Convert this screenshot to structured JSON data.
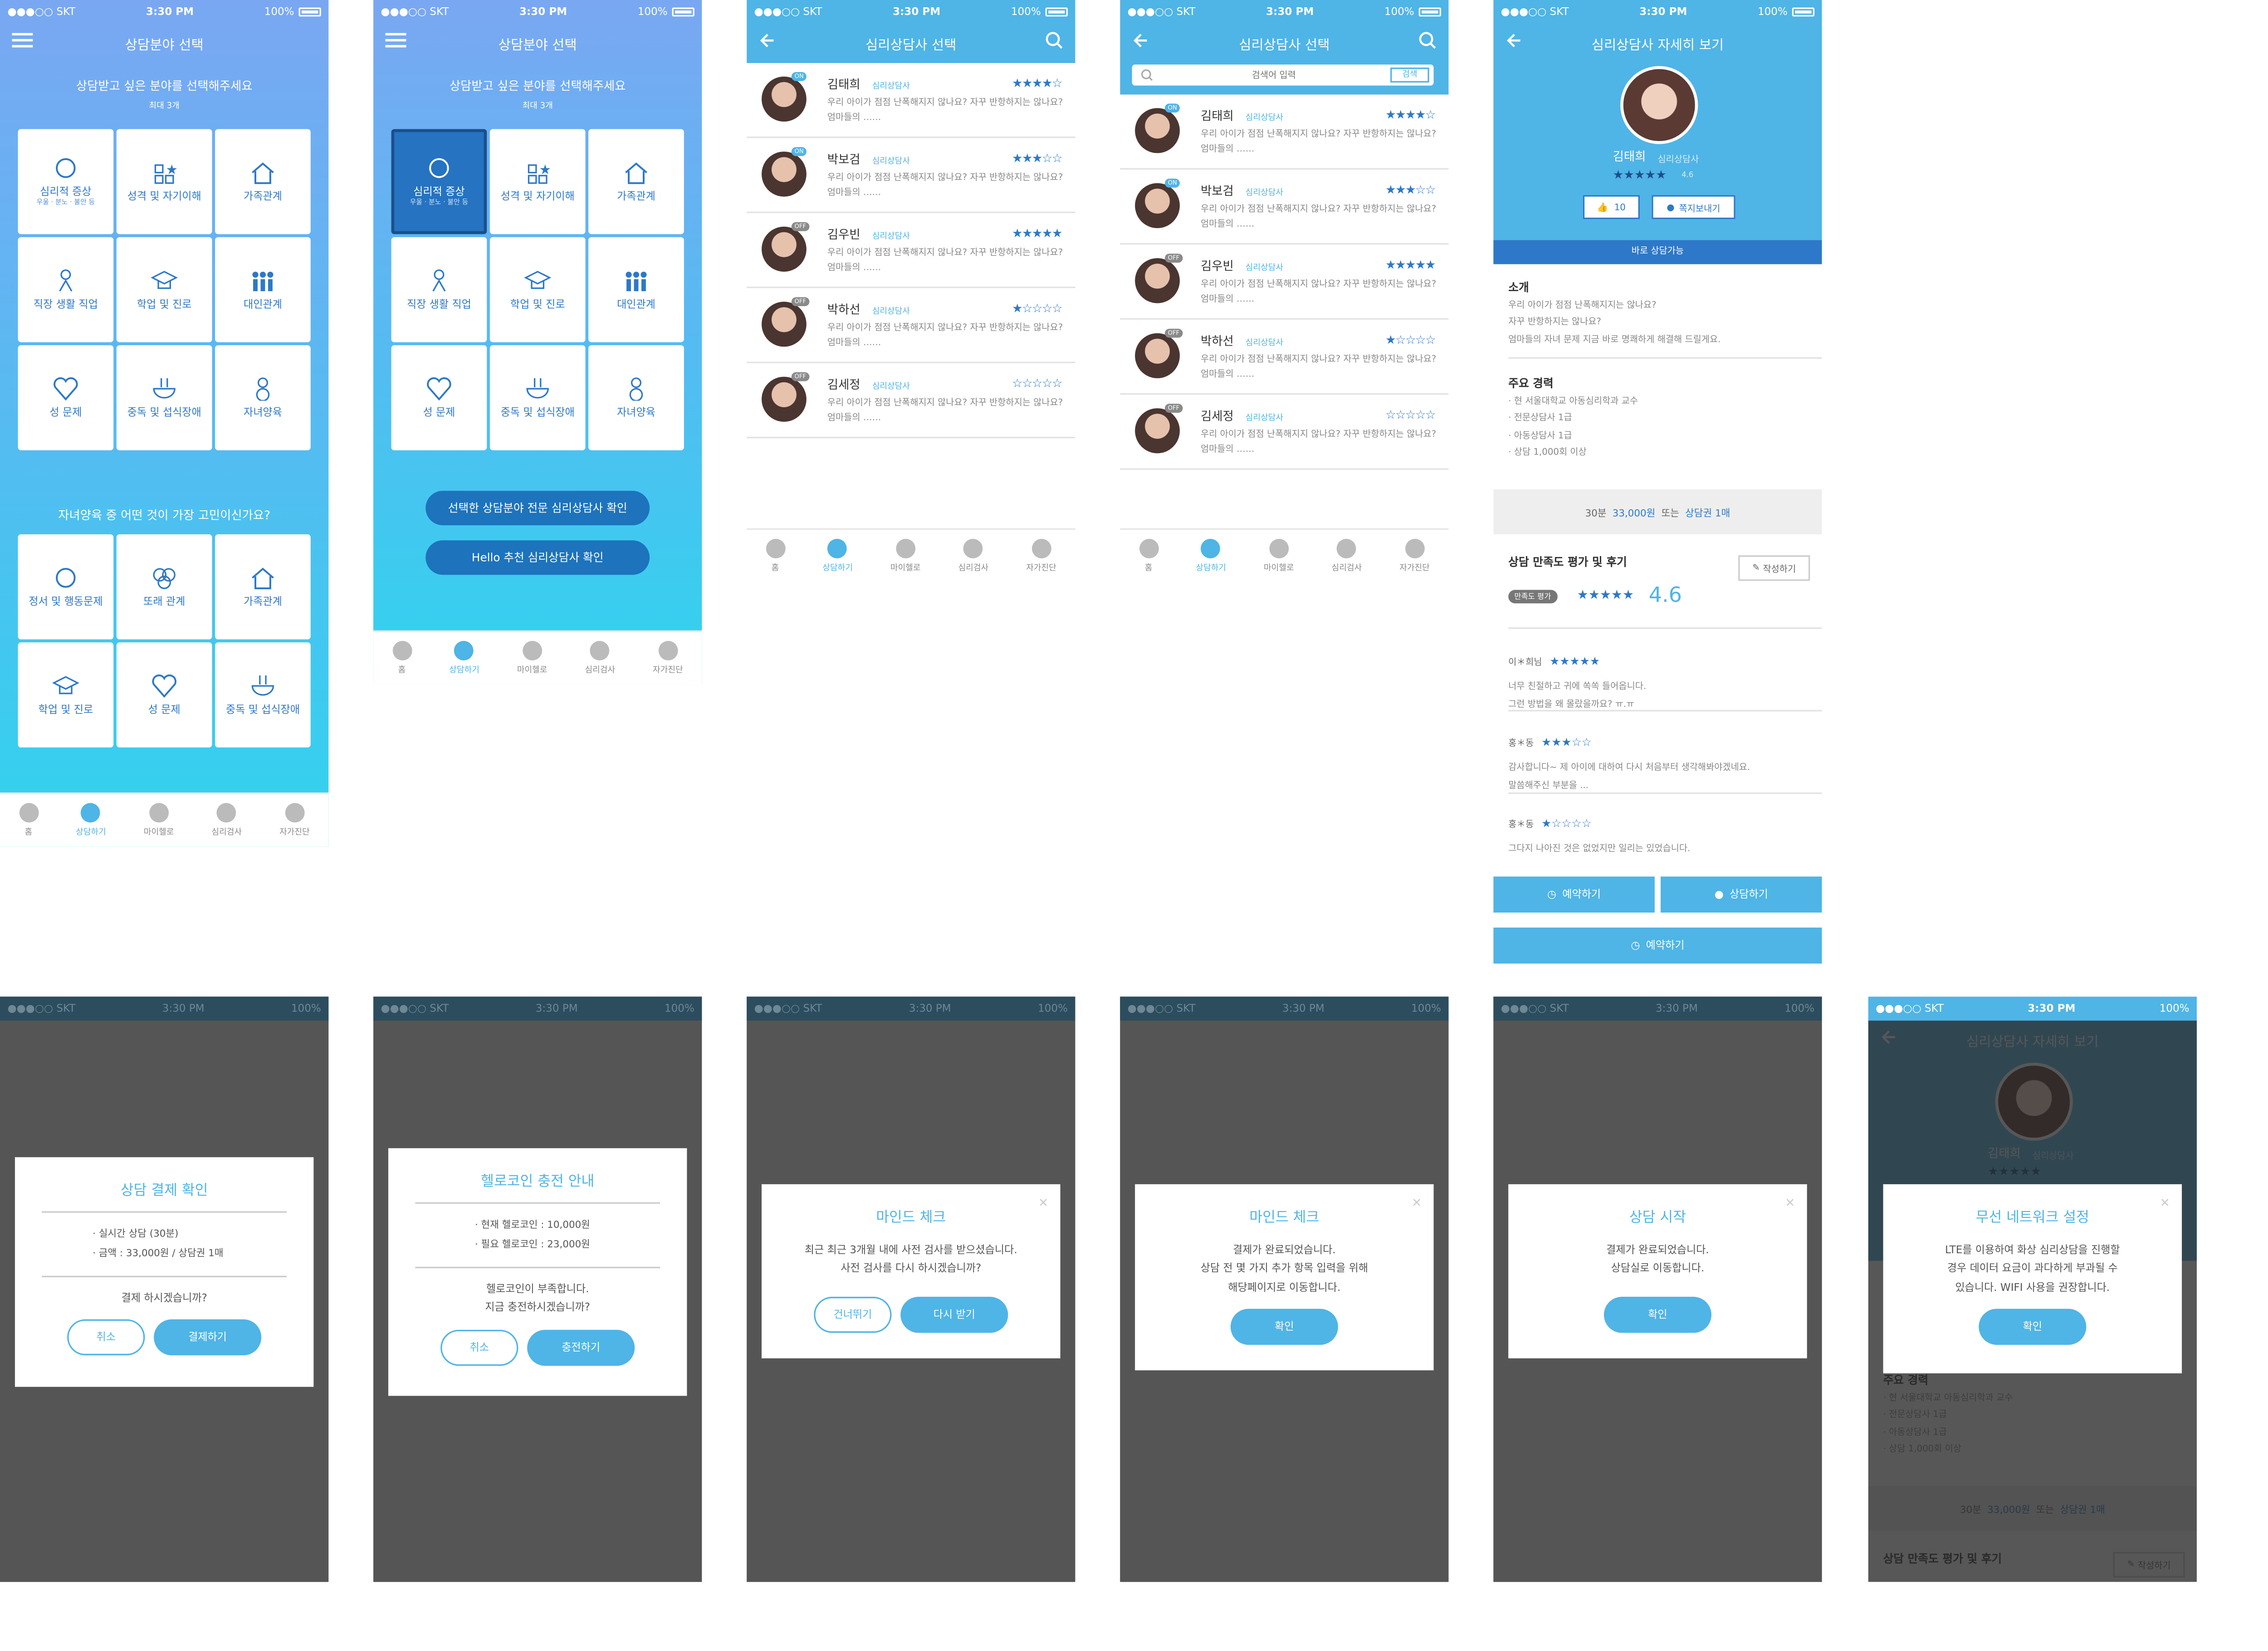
{
  "status": {
    "carrier": "●●●○○ SKT",
    "time": "3:30 PM",
    "battery": "100%"
  },
  "tabbar": [
    "홈",
    "상담하기",
    "마이헬로",
    "심리검사",
    "자가진단"
  ],
  "screen1": {
    "title": "상담분야 선택",
    "prompt": "상담받고 싶은 분야를 선택해주세요",
    "limit": "최대 3개",
    "categories": [
      {
        "label": "심리적 증상",
        "sub": "우울 · 분노 · 불안 등"
      },
      {
        "label": "성격 및 자기이해",
        "sub": ""
      },
      {
        "label": "가족관계",
        "sub": ""
      },
      {
        "label": "직장 생활 직업",
        "sub": ""
      },
      {
        "label": "학업 및 진로",
        "sub": ""
      },
      {
        "label": "대인관계",
        "sub": ""
      },
      {
        "label": "성 문제",
        "sub": ""
      },
      {
        "label": "중독 및 섭식장애",
        "sub": ""
      },
      {
        "label": "자녀양육",
        "sub": ""
      }
    ],
    "question": "자녀양육 중 어떤 것이 가장 고민이신가요?",
    "sub_categories": [
      "정서 및 행동문제",
      "또래 관계",
      "가족관계",
      "학업 및 진로",
      "성 문제",
      "중독 및 섭식장애"
    ]
  },
  "screen2": {
    "btn_confirm": "선택한 상담분야 전문 심리상담사 확인",
    "btn_recommend": "Hello 추천 심리상담사 확인"
  },
  "screen3": {
    "title": "심리상담사 선택",
    "role": "심리상담사",
    "desc": "우리 아이가 점점 난폭해지지 않나요? 자꾸 반항하지는 않나요? 엄마들의 ……",
    "counselors": [
      {
        "name": "김태희",
        "status": "ON",
        "stars": "★★★★☆"
      },
      {
        "name": "박보검",
        "status": "ON",
        "stars": "★★★☆☆"
      },
      {
        "name": "김우빈",
        "status": "OFF",
        "stars": "★★★★★"
      },
      {
        "name": "박하선",
        "status": "OFF",
        "stars": "★☆☆☆☆"
      },
      {
        "name": "김세정",
        "status": "OFF",
        "stars": "☆☆☆☆☆"
      }
    ]
  },
  "screen4": {
    "search_placeholder": "검색어 입력",
    "search_button": "검색"
  },
  "screen5": {
    "title": "심리상담사 자세히 보기",
    "name": "김태희",
    "role": "심리상담사",
    "stars": "★★★★★",
    "rating_small": "4.6",
    "likes": "10",
    "message_btn": "쪽지보내기",
    "available": "바로 상담가능",
    "intro_title": "소개",
    "intro_lines": [
      "우리 아이가 점점 난폭해지지는 않나요?",
      "자꾸 반항하지는 않나요?",
      "엄마들의 자녀 문제 지금 바로 명쾌하게 해결해 드릴게요."
    ],
    "career_title": "주요 경력",
    "career_lines": [
      "· 현 서울대학교 아동심리학과 교수",
      "· 전문상담사 1급",
      "· 아동상담사 1급",
      "· 상담 1,000회 이상"
    ],
    "price_prefix": "30분",
    "price": "33,000원",
    "price_or": "또는",
    "price_ticket": "상담권 1매",
    "review_title": "상담 만족도 평가 및 후기",
    "write": "작성하기",
    "score_label": "만족도 평가",
    "score_stars": "★★★★★",
    "score": "4.6",
    "reviews": [
      {
        "name": "이＊희님",
        "stars": "★★★★★",
        "lines": [
          "너무 친절하고 귀에 쏙쏙 들어옵니다.",
          "그런 방법을 왜 몰랐을까요? ㅠ.ㅠ"
        ]
      },
      {
        "name": "홍＊동",
        "stars": "★★★☆☆",
        "lines": [
          "감사합니다~ 제 아이에 대하여 다시 처음부터 생각해봐야겠네요.",
          "말씀해주신 부분을 ..."
        ]
      },
      {
        "name": "홍＊동",
        "stars": "★☆☆☆☆",
        "lines": [
          "그다지 나아진 것은 없었지만 일리는 있었습니다."
        ]
      }
    ],
    "btn_reserve": "예약하기",
    "btn_consult": "상담하기",
    "btn_reserve2": "예약하기"
  },
  "dialogs": {
    "payment": {
      "title": "상담 결제 확인",
      "lines": [
        "· 실시간 상담 (30분)",
        "· 금액 : 33,000원 / 상담권 1매"
      ],
      "question": "결제 하시겠습니까?",
      "cancel": "취소",
      "ok": "결제하기"
    },
    "charge": {
      "title": "헬로코인 충전 안내",
      "lines": [
        "· 현재 헬로코인 : 10,000원",
        "· 필요 헬로코인 : 23,000원"
      ],
      "body": [
        "헬로코인이 부족합니다.",
        "지금 충전하시겠습니까?"
      ],
      "cancel": "취소",
      "ok": "충전하기"
    },
    "mind1": {
      "title": "마인드 체크",
      "body": [
        "최근 최근 3개월 내에 사전 검사를 받으셨습니다.",
        "사전 검사를 다시 하시겠습니까?"
      ],
      "skip": "건너뛰기",
      "ok": "다시 받기"
    },
    "mind2": {
      "title": "마인드 체크",
      "body": [
        "결제가 완료되었습니다.",
        "상담 전 몇 가지 추가 항목 입력을 위해",
        "해당페이지로 이동합니다."
      ],
      "ok": "확인"
    },
    "start": {
      "title": "상담 시작",
      "body": [
        "결제가 완료되었습니다.",
        "상담실로 이동합니다."
      ],
      "ok": "확인"
    },
    "wifi": {
      "title": "무선 네트워크 설정",
      "body": [
        "LTE를 이용하여 화상 심리상담을 진행할",
        "경우 데이터 요금이 과다하게 부과될 수",
        "있습니다. WIFI 사용을 권장합니다."
      ],
      "ok": "확인"
    }
  }
}
